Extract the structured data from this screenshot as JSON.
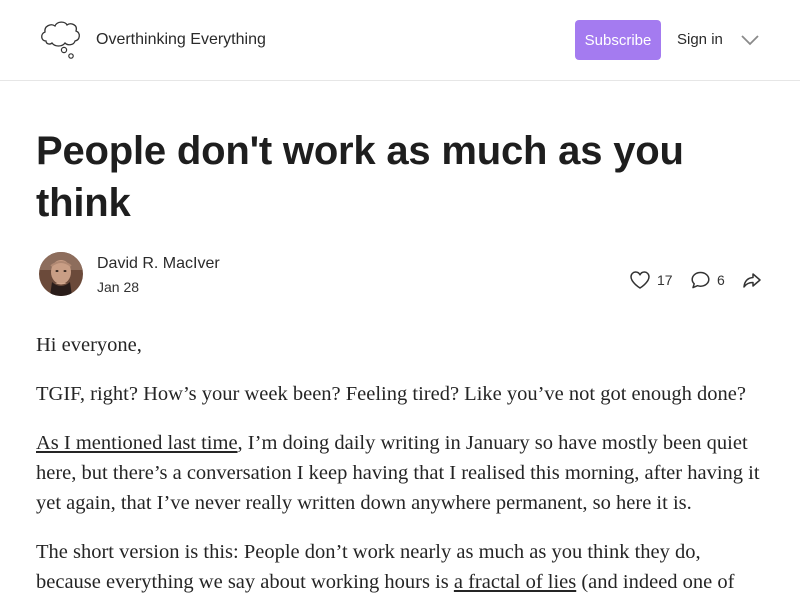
{
  "header": {
    "publication_name": "Overthinking Everything",
    "subscribe_label": "Subscribe",
    "signin_label": "Sign in",
    "logo_icon": "thought-cloud-icon",
    "menu_icon": "chevron-down-icon"
  },
  "post": {
    "title": "People don't work as much as you think",
    "author": "David R. MacIver",
    "date": "Jan 28",
    "likes": "17",
    "comments": "6",
    "like_icon": "heart-icon",
    "comment_icon": "comment-bubble-icon",
    "share_icon": "share-arrow-icon"
  },
  "body": {
    "p1": "Hi everyone,",
    "p2": "TGIF, right? How’s your week been? Feeling tired? Like you’ve not got enough done?",
    "p3_link": "As I mentioned last time",
    "p3_rest": ", I’m doing daily writing in January so have mostly been quiet here, but there’s a conversation I keep having that I realised this morning, after having it yet again, that I’ve never really written down anywhere permanent, so here it is.",
    "p4_start": "The short version is this: People don’t work nearly as much as you think they do, because everything we say about working hours is ",
    "p4_link": "a fractal of lies",
    "p4_end": " (and indeed one of"
  },
  "colors": {
    "accent": "#a47bf0",
    "text": "#252525",
    "divider": "#e6e6e6"
  }
}
